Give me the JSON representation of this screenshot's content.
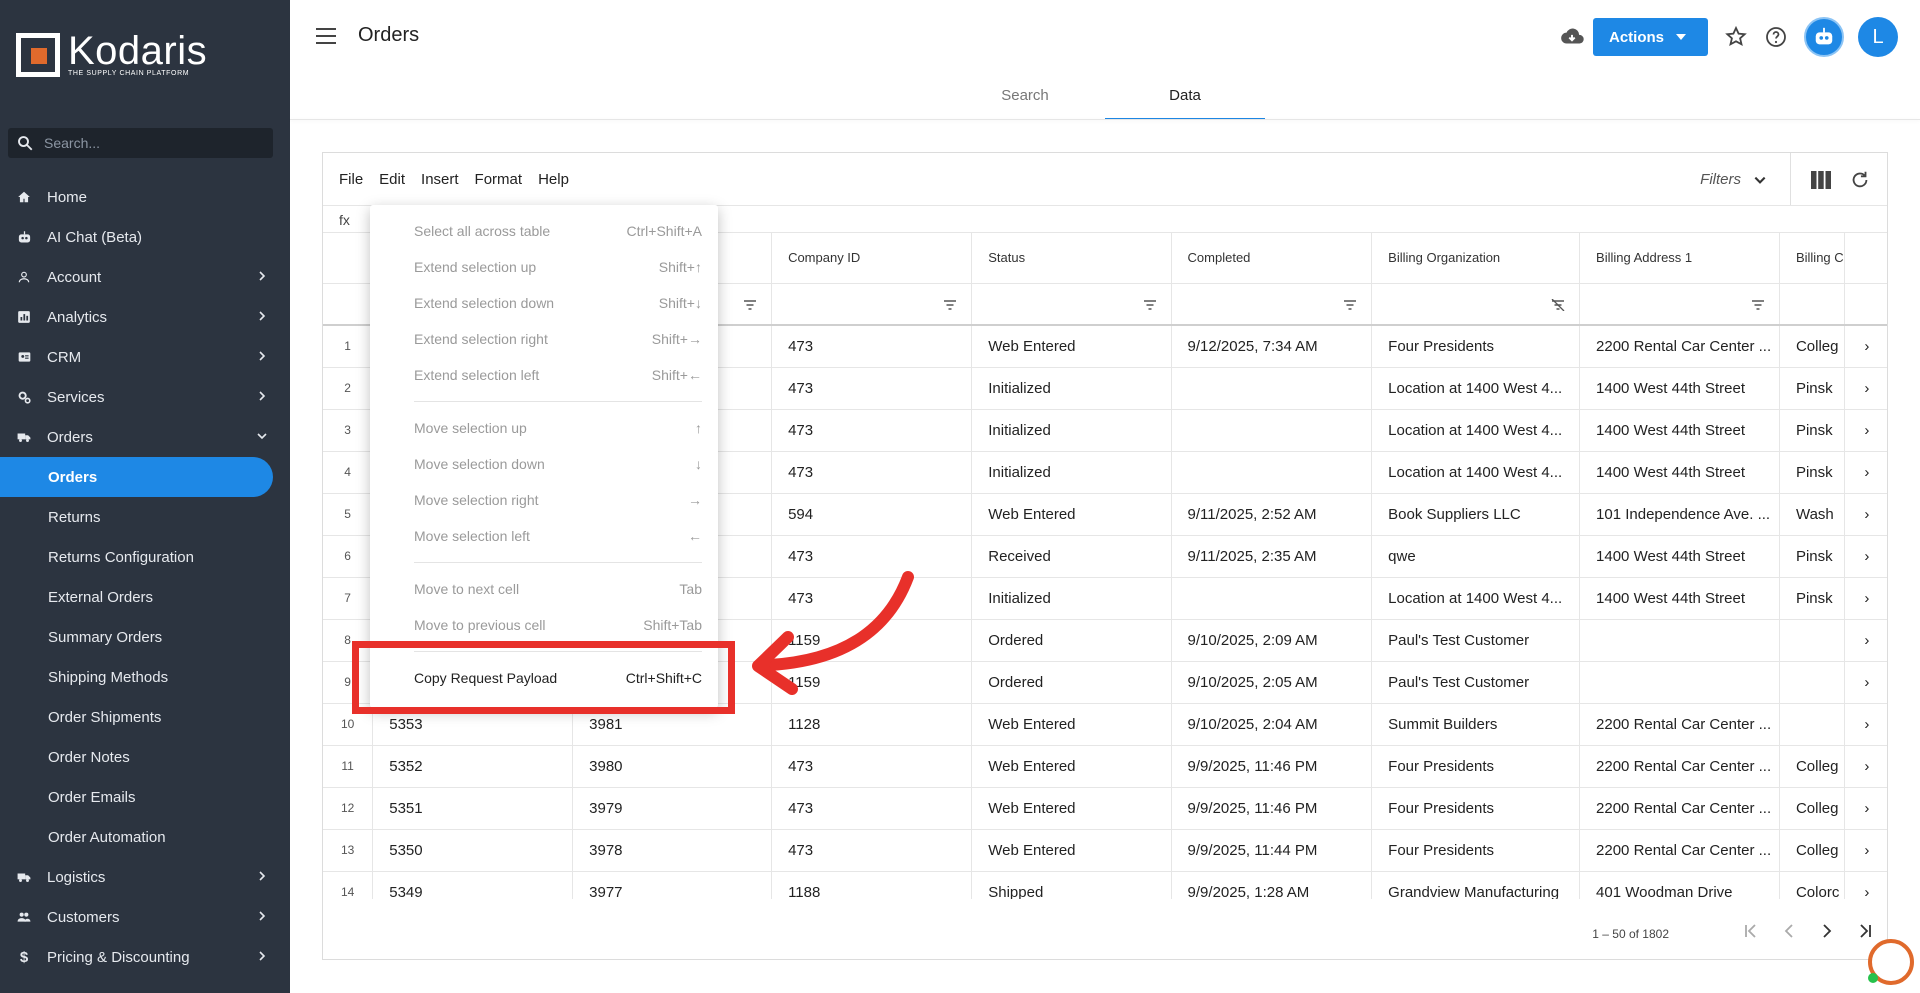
{
  "app": {
    "logo_name": "Kodaris",
    "logo_tagline": "THE SUPPLY CHAIN PLATFORM"
  },
  "sidebar": {
    "search_placeholder": "Search...",
    "items": [
      {
        "label": "Home",
        "icon": "home-icon"
      },
      {
        "label": "AI Chat (Beta)",
        "icon": "robot-icon"
      },
      {
        "label": "Account",
        "icon": "person-icon",
        "chevron": true
      },
      {
        "label": "Analytics",
        "icon": "chart-icon",
        "chevron": true
      },
      {
        "label": "CRM",
        "icon": "contact-card-icon",
        "chevron": true
      },
      {
        "label": "Services",
        "icon": "gears-icon",
        "chevron": true
      },
      {
        "label": "Orders",
        "icon": "truck-icon",
        "chevron": "down"
      }
    ],
    "sub_items": [
      "Orders",
      "Returns",
      "Returns Configuration",
      "External Orders",
      "Summary Orders",
      "Shipping Methods",
      "Order Shipments",
      "Order Notes",
      "Order Emails",
      "Order Automation"
    ],
    "bottom_items": [
      {
        "label": "Logistics",
        "icon": "truck-icon"
      },
      {
        "label": "Customers",
        "icon": "people-icon"
      },
      {
        "label": "Pricing & Discounting",
        "icon": "dollar-icon"
      }
    ]
  },
  "header": {
    "title": "Orders",
    "actions_label": "Actions",
    "avatar_initial": "L",
    "tabs": [
      "Search",
      "Data"
    ],
    "active_tab": "Data"
  },
  "grid": {
    "menu": [
      "File",
      "Edit",
      "Insert",
      "Format",
      "Help"
    ],
    "filters_label": "Filters",
    "fx_label": "fx",
    "columns": [
      "",
      "",
      "",
      "Company ID",
      "Status",
      "Completed",
      "Billing Organization",
      "Billing Address 1",
      "Billing C"
    ],
    "rows": [
      {
        "n": "1",
        "a": "",
        "b": "",
        "company": "473",
        "status": "Web Entered",
        "completed": "9/12/2025, 7:34 AM",
        "org": "Four Presidents",
        "addr": "2200 Rental Car Center ...",
        "city": "Colleg"
      },
      {
        "n": "2",
        "a": "",
        "b": "",
        "company": "473",
        "status": "Initialized",
        "completed": "",
        "org": "Location at 1400 West 4...",
        "addr": "1400 West 44th Street",
        "city": "Pinsk"
      },
      {
        "n": "3",
        "a": "",
        "b": "",
        "company": "473",
        "status": "Initialized",
        "completed": "",
        "org": "Location at 1400 West 4...",
        "addr": "1400 West 44th Street",
        "city": "Pinsk"
      },
      {
        "n": "4",
        "a": "",
        "b": "",
        "company": "473",
        "status": "Initialized",
        "completed": "",
        "org": "Location at 1400 West 4...",
        "addr": "1400 West 44th Street",
        "city": "Pinsk"
      },
      {
        "n": "5",
        "a": "",
        "b": "",
        "company": "594",
        "status": "Web Entered",
        "completed": "9/11/2025, 2:52 AM",
        "org": "Book Suppliers LLC",
        "addr": "101 Independence Ave. ...",
        "city": "Wash"
      },
      {
        "n": "6",
        "a": "",
        "b": "",
        "company": "473",
        "status": "Received",
        "completed": "9/11/2025, 2:35 AM",
        "org": "qwe",
        "addr": "1400 West 44th Street",
        "city": "Pinsk"
      },
      {
        "n": "7",
        "a": "",
        "b": "",
        "company": "473",
        "status": "Initialized",
        "completed": "",
        "org": "Location at 1400 West 4...",
        "addr": "1400 West 44th Street",
        "city": "Pinsk"
      },
      {
        "n": "8",
        "a": "",
        "b": "",
        "company": "1159",
        "status": "Ordered",
        "completed": "9/10/2025, 2:09 AM",
        "org": "Paul's Test Customer",
        "addr": "",
        "city": ""
      },
      {
        "n": "9",
        "a": "",
        "b": "",
        "company": "1159",
        "status": "Ordered",
        "completed": "9/10/2025, 2:05 AM",
        "org": "Paul's Test Customer",
        "addr": "",
        "city": ""
      },
      {
        "n": "10",
        "a": "5353",
        "b": "3981",
        "company": "1128",
        "status": "Web Entered",
        "completed": "9/10/2025, 2:04 AM",
        "org": "Summit Builders",
        "addr": "2200 Rental Car Center ...",
        "city": ""
      },
      {
        "n": "11",
        "a": "5352",
        "b": "3980",
        "company": "473",
        "status": "Web Entered",
        "completed": "9/9/2025, 11:46 PM",
        "org": "Four Presidents",
        "addr": "2200 Rental Car Center ...",
        "city": "Colleg"
      },
      {
        "n": "12",
        "a": "5351",
        "b": "3979",
        "company": "473",
        "status": "Web Entered",
        "completed": "9/9/2025, 11:46 PM",
        "org": "Four Presidents",
        "addr": "2200 Rental Car Center ...",
        "city": "Colleg"
      },
      {
        "n": "13",
        "a": "5350",
        "b": "3978",
        "company": "473",
        "status": "Web Entered",
        "completed": "9/9/2025, 11:44 PM",
        "org": "Four Presidents",
        "addr": "2200 Rental Car Center ...",
        "city": "Colleg"
      },
      {
        "n": "14",
        "a": "5349",
        "b": "3977",
        "company": "1188",
        "status": "Shipped",
        "completed": "9/9/2025, 1:28 AM",
        "org": "Grandview Manufacturing",
        "addr": "401 Woodman Drive",
        "city": "Colorc"
      }
    ],
    "pager_text": "1 – 50 of 1802"
  },
  "context_menu": {
    "groups": [
      [
        {
          "label": "Select all across table",
          "shortcut": "Ctrl+Shift+A"
        },
        {
          "label": "Extend selection up",
          "shortcut": "Shift+↑"
        },
        {
          "label": "Extend selection down",
          "shortcut": "Shift+↓"
        },
        {
          "label": "Extend selection right",
          "shortcut": "Shift+→"
        },
        {
          "label": "Extend selection left",
          "shortcut": "Shift+←"
        }
      ],
      [
        {
          "label": "Move selection up",
          "shortcut": "↑"
        },
        {
          "label": "Move selection down",
          "shortcut": "↓"
        },
        {
          "label": "Move selection right",
          "shortcut": "→"
        },
        {
          "label": "Move selection left",
          "shortcut": "←"
        }
      ],
      [
        {
          "label": "Move to next cell",
          "shortcut": "Tab"
        },
        {
          "label": "Move to previous cell",
          "shortcut": "Shift+Tab"
        }
      ],
      [
        {
          "label": "Copy Request Payload",
          "shortcut": "Ctrl+Shift+C"
        }
      ]
    ]
  },
  "colors": {
    "sidebar_bg": "#2c3440",
    "accent": "#1e88e5",
    "annotation": "#e8302a",
    "logo_orange": "#e06a2c"
  }
}
